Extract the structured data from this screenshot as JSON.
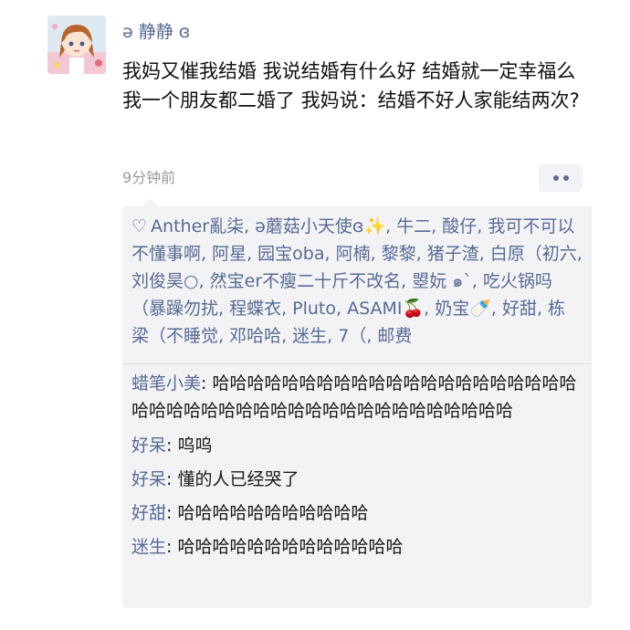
{
  "post": {
    "username": "ə 静静 ɞ",
    "text": "我妈又催我结婚 我说结婚有什么好 结婚就一定幸福么 我一个朋友都二婚了 我妈说：结婚不好人家能结两次?",
    "time": "9分钟前",
    "more_icon": "more-dots-icon"
  },
  "likes": {
    "icon": "heart-outline-icon",
    "names": "Anther亂柒, ə蘑菇小天使ɞ✨, 牛二, 酸仔, 我可不可以不懂事啊, 阿星, 园宝oba, 阿楠, 黎黎, 猪子渣, 白原（初六, 刘俊昊○, 然宝er不瘦二十斤不改名, 曌妧 ๑`, 吃火锅吗（暴躁勿扰, 程蝶衣, Pluto, ASAMI🍒, 奶宝🍼, 好甜, 栋梁（不睡觉, 邓哈哈, 迷生, 7（, 邮费"
  },
  "comments": [
    {
      "author": "蜡笔小美",
      "sep": ": ",
      "text": "哈哈哈哈哈哈哈哈哈哈哈哈哈哈哈哈哈哈哈哈哈哈哈哈哈哈哈哈哈哈哈哈哈哈哈哈哈哈哈哈哈哈哈"
    },
    {
      "author": "好呆",
      "sep": ": ",
      "text": "呜呜"
    },
    {
      "author": "好呆",
      "sep": ": ",
      "text": "懂的人已经哭了"
    },
    {
      "author": "好甜",
      "sep": ": ",
      "text": "哈哈哈哈哈哈哈哈哈哈哈"
    },
    {
      "author": "迷生",
      "sep": ": ",
      "text": "哈哈哈哈哈哈哈哈哈哈哈哈哈"
    }
  ]
}
